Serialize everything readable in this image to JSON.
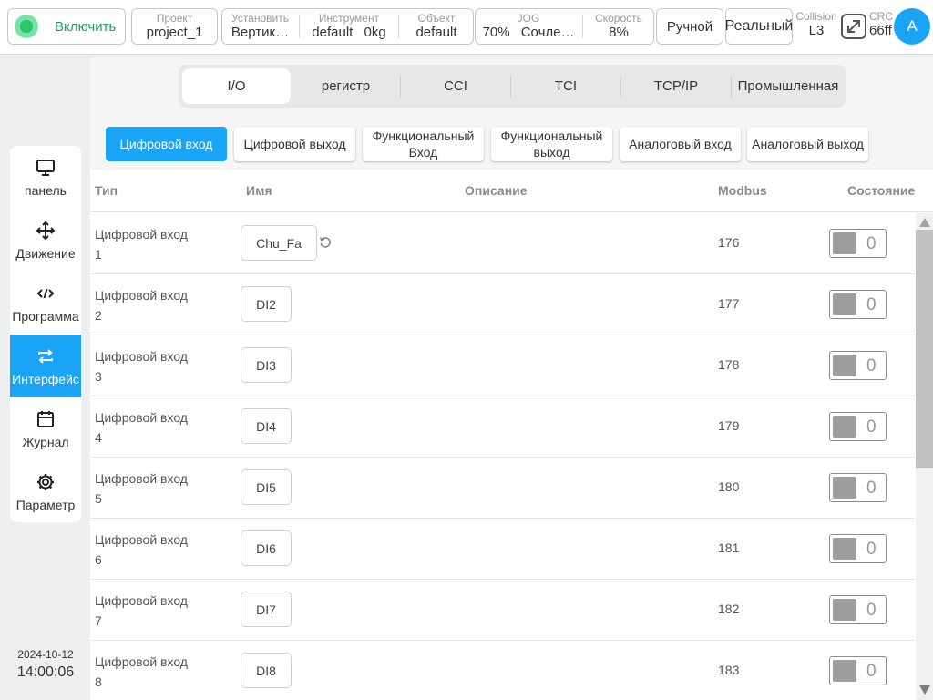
{
  "topbar": {
    "enable_label": "Включить",
    "project": {
      "caption": "Проект",
      "value": "project_1"
    },
    "install": {
      "caption": "Установить",
      "value": "Вертик…"
    },
    "tool": {
      "caption": "Инструмент",
      "value": "default",
      "extra": "0kg"
    },
    "object": {
      "caption": "Объект",
      "value": "default"
    },
    "jog": {
      "caption": "JOG",
      "value": "70%",
      "extra": "Сочле…"
    },
    "speed": {
      "caption": "Скорость",
      "value": "8%"
    },
    "mode_manual": "Ручной",
    "mode_real": "Реальный",
    "collision": {
      "caption": "Collision",
      "value": "L3"
    },
    "crc": {
      "caption": "CRC",
      "value": "66ff"
    },
    "avatar": "A"
  },
  "sidebar": {
    "items": [
      {
        "label": "панель",
        "icon": "monitor-icon"
      },
      {
        "label": "Движение",
        "icon": "move-icon"
      },
      {
        "label": "Программа",
        "icon": "code-icon"
      },
      {
        "label": "Интерфейс",
        "icon": "swap-icon"
      },
      {
        "label": "Журнал",
        "icon": "calendar-icon"
      },
      {
        "label": "Параметр",
        "icon": "gear-icon"
      }
    ],
    "active_index": 3,
    "date": "2024-10-12",
    "time": "14:00:06"
  },
  "tabs": [
    "I/O",
    "регистр",
    "CCI",
    "TCI",
    "TCP/IP",
    "Промышленная"
  ],
  "subtabs": [
    "Цифровой вход",
    "Цифровой выход",
    "Функциональный Вход",
    "Функциональный выход",
    "Аналоговый вход",
    "Аналоговый выход"
  ],
  "table": {
    "headers": {
      "type": "Тип",
      "name": "Имя",
      "description": "Описание",
      "modbus": "Modbus",
      "state": "Состояние"
    },
    "rows": [
      {
        "type": "Цифровой вход",
        "index": "1",
        "name": "Chu_Fa",
        "modbus": "176",
        "state": "0"
      },
      {
        "type": "Цифровой вход",
        "index": "2",
        "name": "DI2",
        "modbus": "177",
        "state": "0"
      },
      {
        "type": "Цифровой вход",
        "index": "3",
        "name": "DI3",
        "modbus": "178",
        "state": "0"
      },
      {
        "type": "Цифровой вход",
        "index": "4",
        "name": "DI4",
        "modbus": "179",
        "state": "0"
      },
      {
        "type": "Цифровой вход",
        "index": "5",
        "name": "DI5",
        "modbus": "180",
        "state": "0"
      },
      {
        "type": "Цифровой вход",
        "index": "6",
        "name": "DI6",
        "modbus": "181",
        "state": "0"
      },
      {
        "type": "Цифровой вход",
        "index": "7",
        "name": "DI7",
        "modbus": "182",
        "state": "0"
      },
      {
        "type": "Цифровой вход",
        "index": "8",
        "name": "DI8",
        "modbus": "183",
        "state": "0"
      }
    ]
  },
  "colors": {
    "accent": "#1aa4f5",
    "enable_green": "#1ba05a",
    "state_gray": "#9e9e9e"
  }
}
